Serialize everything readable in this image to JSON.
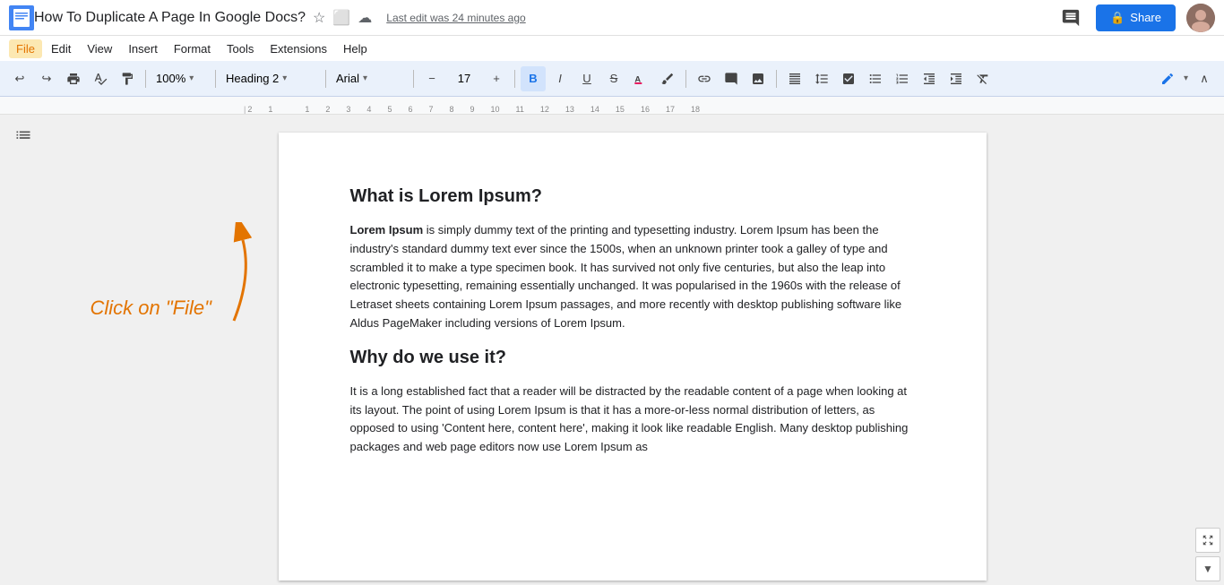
{
  "titleBar": {
    "docTitle": "How To Duplicate A Page In Google Docs?",
    "lastEdit": "Last edit was 24 minutes ago",
    "shareLabel": "Share",
    "commentsIcon": "💬"
  },
  "menuBar": {
    "items": [
      "File",
      "Edit",
      "View",
      "Insert",
      "Format",
      "Tools",
      "Extensions",
      "Help"
    ],
    "active": "File"
  },
  "toolbar": {
    "undoLabel": "↩",
    "redoLabel": "↪",
    "printLabel": "🖨",
    "spellLabel": "✓",
    "paintLabel": "🖌",
    "zoom": "100%",
    "style": "Heading 2",
    "font": "Arial",
    "fontSizeMinus": "−",
    "fontSize": "17",
    "fontSizePlus": "+",
    "boldLabel": "B",
    "italicLabel": "I",
    "underlineLabel": "U",
    "strikeLabel": "S",
    "highlightLabel": "A",
    "penLabel": "✏"
  },
  "annotation": {
    "text": "Click on \"File\"",
    "arrow": "↗"
  },
  "document": {
    "heading1": "What is Lorem Ipsum?",
    "para1_bold": "Lorem Ipsum",
    "para1_rest": " is simply dummy text of the printing and typesetting industry. Lorem Ipsum has been the industry's standard dummy text ever since the 1500s, when an unknown printer took a galley of type and scrambled it to make a type specimen book. It has survived not only five centuries, but also the leap into electronic typesetting, remaining essentially unchanged. It was popularised in the 1960s with the release of Letraset sheets containing Lorem Ipsum passages, and more recently with desktop publishing software like Aldus PageMaker including versions of Lorem Ipsum.",
    "heading2": "Why do we use it?",
    "para2": "It is a long established fact that a reader will be distracted by the readable content of a page when looking at its layout. The point of using Lorem Ipsum is that it has a more-or-less normal distribution of letters, as opposed to using 'Content here, content here', making it look like readable English. Many desktop publishing packages and web page editors now use Lorem Ipsum as"
  }
}
